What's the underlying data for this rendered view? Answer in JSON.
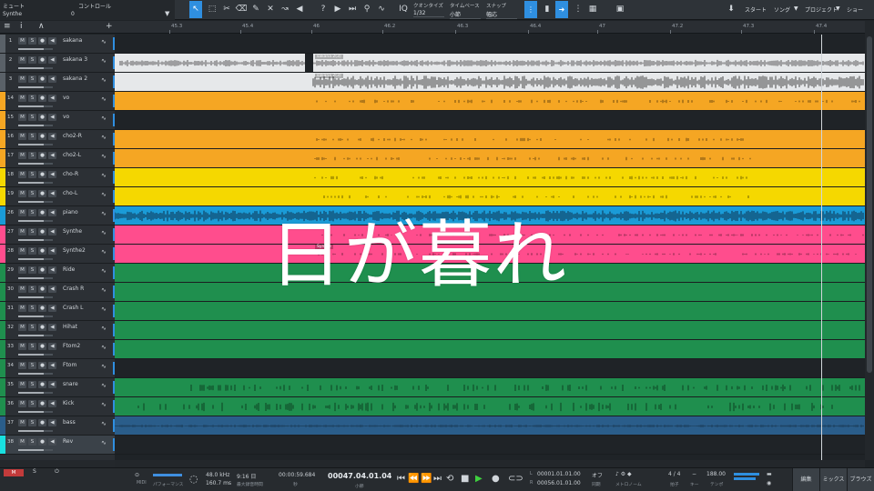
{
  "toolbar": {
    "mute_label": "ミュート",
    "track_name": "Synthe",
    "control_label": "コントロール",
    "control_value": "0",
    "quantize_label": "クオンタイズ",
    "quantize_value": "1/32",
    "timebase_label": "タイムベース",
    "timebase_value": "小節",
    "snap_label": "スナップ",
    "snap_value": "幅応",
    "start_label": "スタート",
    "song_label": "ソング",
    "project_label": "プロジェクト",
    "show_label": "ショー"
  },
  "ruler": [
    "45.3",
    "45.4",
    "46",
    "46.2",
    "46.3",
    "46.4",
    "47",
    "47.2",
    "47.3",
    "47.4"
  ],
  "tracks": [
    {
      "num": "1",
      "name": "sakana",
      "color": "#3a3f45"
    },
    {
      "num": "2",
      "name": "sakana 3",
      "color": "#3a3f45"
    },
    {
      "num": "3",
      "name": "sakana 2",
      "color": "#3a3f45"
    },
    {
      "num": "14",
      "name": "vo",
      "color": "#f5a623"
    },
    {
      "num": "15",
      "name": "vo",
      "color": "#f5a623"
    },
    {
      "num": "16",
      "name": "cho2-R",
      "color": "#f5a623"
    },
    {
      "num": "17",
      "name": "cho2-L",
      "color": "#f5a623"
    },
    {
      "num": "18",
      "name": "cho-R",
      "color": "#f5d800"
    },
    {
      "num": "19",
      "name": "cho-L",
      "color": "#f5d800"
    },
    {
      "num": "26",
      "name": "piano",
      "color": "#1a9bd7"
    },
    {
      "num": "27",
      "name": "Synthe",
      "color": "#ff4d8d"
    },
    {
      "num": "28",
      "name": "Synthe2",
      "color": "#ff4d8d"
    },
    {
      "num": "29",
      "name": "Ride",
      "color": "#1f8f4e"
    },
    {
      "num": "30",
      "name": "Crash R",
      "color": "#1f8f4e"
    },
    {
      "num": "31",
      "name": "Crash L",
      "color": "#1f8f4e"
    },
    {
      "num": "32",
      "name": "Hihat",
      "color": "#1f8f4e"
    },
    {
      "num": "33",
      "name": "Ftom2",
      "color": "#1f8f4e"
    },
    {
      "num": "34",
      "name": "Ftom",
      "color": "#1f8f4e"
    },
    {
      "num": "35",
      "name": "snare",
      "color": "#1f8f4e"
    },
    {
      "num": "36",
      "name": "Kick",
      "color": "#1f8f4e"
    },
    {
      "num": "37",
      "name": "bass",
      "color": "#2a5d8a"
    },
    {
      "num": "38",
      "name": "Rev",
      "color": "#3b4249"
    }
  ],
  "events": {
    "sakana_label": "sakana 2(3)",
    "synthe_label": "Synthe"
  },
  "lyrics": "日が暮れ",
  "transport": {
    "midi_label": "MIDI",
    "performance_label": "パフォーマンス",
    "sample_rate": "48.0 kHz",
    "latency": "160.7 ms",
    "record_time": "9:16 日",
    "record_caption": "最大録音時間",
    "time_seconds": "00:00:59.684",
    "time_caption": "秒",
    "position": "00047.04.01.04",
    "position_caption": "小節",
    "loop_start": "00001.01.01.00",
    "loop_end": "00056.01.01.00",
    "loop_caption_l": "L",
    "loop_caption_r": "R",
    "off_label": "オフ",
    "sync_label": "同期",
    "metronome_label": "メトロノーム",
    "time_sig": "4 / 4",
    "time_sig_caption": "拍子",
    "key_caption": "キー",
    "tempo": "188.00",
    "tempo_caption": "テンポ",
    "edit_tab": "編集",
    "mix_tab": "ミックス",
    "browse_tab": "ブラウズ"
  }
}
